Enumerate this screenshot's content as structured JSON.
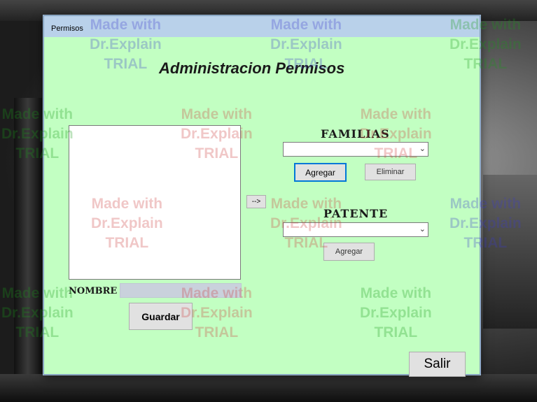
{
  "window": {
    "title": "Permisos"
  },
  "heading": "Administracion Permisos",
  "move_button": "-->",
  "familias": {
    "label": "FAMILIAS",
    "selected": "",
    "add_label": "Agregar",
    "remove_label": "Eliminar"
  },
  "patente": {
    "label": "PATENTE",
    "selected": "",
    "add_label": "Agregar"
  },
  "nombre": {
    "label": "NOMBRE",
    "value": ""
  },
  "save_label": "Guardar",
  "exit_label": "Salir",
  "watermark": {
    "line1": "Made with",
    "line2": "Dr.Explain",
    "line3": "TRIAL"
  },
  "colors": {
    "client_bg": "#c2ffc2",
    "titlebar": "#b9d1ea",
    "focus_border": "#0078d7"
  }
}
